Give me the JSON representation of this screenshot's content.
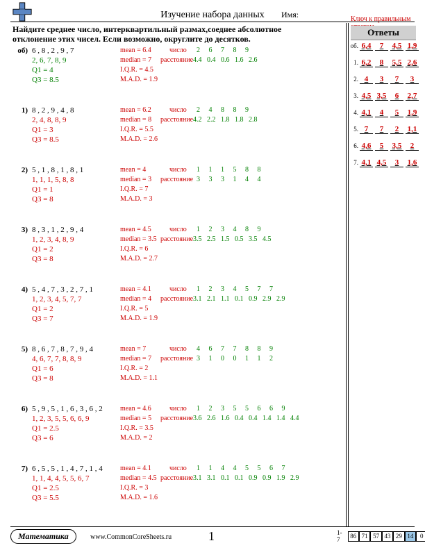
{
  "header": {
    "title": "Изучение набора данных",
    "name_label": "Имя:",
    "answer_key_label": "Ключ к правильным ответам"
  },
  "instructions": "Найдите среднее число, интерквартильный размах,соеднее абсолютное отклонение этих чисел. Если возможно, округлите до десятков.",
  "labels": {
    "mean": "mean =",
    "median": "median =",
    "iqr": "I.Q.R. =",
    "mad": "M.A.D. =",
    "number": "число",
    "distance": "расстояние",
    "q1": "Q1 =",
    "q3": "Q3 ="
  },
  "problems": [
    {
      "num": "об)",
      "data": "6 , 8 , 2 , 9 , 7",
      "sorted": "2, 6, 7, 8, 9",
      "q1": "4",
      "q3": "8.5",
      "mean": "6.4",
      "median": "7",
      "iqr": "4.5",
      "mad": "1.9",
      "numbers": "  2     6     7     8     9",
      "distances": "4.4   0.4   0.6   1.6   2.6",
      "sample": true
    },
    {
      "num": "1)",
      "data": "8 , 2 , 9 , 4 , 8",
      "sorted": "2, 4, 8, 8, 9",
      "q1": "3",
      "q3": "8.5",
      "mean": "6.2",
      "median": "8",
      "iqr": "5.5",
      "mad": "2.6",
      "numbers": "  2     4     8     8     9",
      "distances": "4.2   2.2   1.8   1.8   2.8"
    },
    {
      "num": "2)",
      "data": "5 , 1 , 8 , 1 , 8 , 1",
      "sorted": "1, 1, 1, 5, 8, 8",
      "q1": "1",
      "q3": "8",
      "mean": "4",
      "median": "3",
      "iqr": "7",
      "mad": "3",
      "numbers": "  1     1     1     5     8     8",
      "distances": "  3     3     3     1     4     4"
    },
    {
      "num": "3)",
      "data": "8 , 3 , 1 , 2 , 9 , 4",
      "sorted": "1, 2, 3, 4, 8, 9",
      "q1": "2",
      "q3": "8",
      "mean": "4.5",
      "median": "3.5",
      "iqr": "6",
      "mad": "2.7",
      "numbers": "  1     2     3     4     8     9",
      "distances": "3.5   2.5   1.5   0.5   3.5   4.5"
    },
    {
      "num": "4)",
      "data": "5 , 4 , 7 , 3 , 2 , 7 , 1",
      "sorted": "1, 2, 3, 4, 5, 7, 7",
      "q1": "2",
      "q3": "7",
      "mean": "4.1",
      "median": "4",
      "iqr": "5",
      "mad": "1.9",
      "numbers": "  1     2     3     4     5     7     7",
      "distances": "3.1   2.1   1.1   0.1   0.9   2.9   2.9"
    },
    {
      "num": "5)",
      "data": "8 , 6 , 7 , 8 , 7 , 9 , 4",
      "sorted": "4, 6, 7, 7, 8, 8, 9",
      "q1": "6",
      "q3": "8",
      "mean": "7",
      "median": "7",
      "iqr": "2",
      "mad": "1.1",
      "numbers": "  4     6     7     7     8     8     9",
      "distances": "  3     1     0     0     1     1     2"
    },
    {
      "num": "6)",
      "data": "5 , 9 , 5 , 1 , 6 , 3 , 6 , 2",
      "sorted": "1, 2, 3, 5, 5, 6, 6, 9",
      "q1": "2.5",
      "q3": "6",
      "mean": "4.6",
      "median": "5",
      "iqr": "3.5",
      "mad": "2",
      "numbers": "  1     2     3     5     5     6     6     9",
      "distances": "3.6   2.6   1.6   0.4   0.4   1.4   1.4   4.4"
    },
    {
      "num": "7)",
      "data": "6 , 5 , 5 , 1 , 4 , 7 , 1 , 4",
      "sorted": "1, 1, 4, 4, 5, 5, 6, 7",
      "q1": "2.5",
      "q3": "5.5",
      "mean": "4.1",
      "median": "4.5",
      "iqr": "3",
      "mad": "1.6",
      "numbers": "  1     1     4     4     5     5     6     7",
      "distances": "3.1   3.1   0.1   0.1   0.9   0.9   1.9   2.9"
    }
  ],
  "answers_header": "Ответы",
  "answers": [
    {
      "num": "об.",
      "cells": [
        "6,4",
        "7",
        "4,5",
        "1,9"
      ]
    },
    {
      "num": "1.",
      "cells": [
        "6,2",
        "8",
        "5,5",
        "2,6"
      ]
    },
    {
      "num": "2.",
      "cells": [
        "4",
        "3",
        "7",
        "3"
      ]
    },
    {
      "num": "3.",
      "cells": [
        "4,5",
        "3,5",
        "6",
        "2,7"
      ]
    },
    {
      "num": "4.",
      "cells": [
        "4,1",
        "4",
        "5",
        "1,9"
      ]
    },
    {
      "num": "5.",
      "cells": [
        "7",
        "7",
        "2",
        "1,1"
      ]
    },
    {
      "num": "6.",
      "cells": [
        "4,6",
        "5",
        "3,5",
        "2"
      ]
    },
    {
      "num": "7.",
      "cells": [
        "4,1",
        "4,5",
        "3",
        "1,6"
      ]
    }
  ],
  "footer": {
    "subject": "Математика",
    "url": "www.CommonCoreSheets.ru",
    "page": "1",
    "score_range": "1-7",
    "scores": [
      "86",
      "71",
      "57",
      "43",
      "29",
      "14",
      "0"
    ],
    "highlight_index": 5
  }
}
